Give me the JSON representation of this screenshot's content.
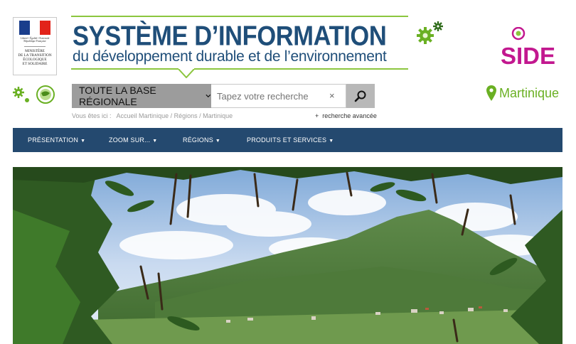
{
  "gov": {
    "motto": "Liberté • Égalité • Fraternité\nRépublique Française",
    "ministry": "MINISTÈRE\nDE LA TRANSITION\nÉCOLOGIQUE\nET SOLIDAIRE"
  },
  "header": {
    "title": "SYSTÈME D’INFORMATION",
    "subtitle": "du développement durable et de l’environnement",
    "brand_color": "#1f4e79",
    "accent_color": "#8cc63f"
  },
  "side": {
    "logo_text": "SIDE",
    "logo_color": "#c2188f",
    "region": "Martinique",
    "region_color": "#6ab023",
    "icons": [
      "location-pin-icon",
      "gear-icon",
      "globe-icon"
    ]
  },
  "search": {
    "scope_label": "TOUTE LA BASE RÉGIONALE",
    "placeholder": "Tapez votre recherche",
    "clear_glyph": "×",
    "advanced_label": "recherche avancée",
    "advanced_prefix": "+"
  },
  "breadcrumb": {
    "prefix": "Vous êtes ici :",
    "items": [
      "Accueil Martinique",
      "Régions",
      "Martinique"
    ]
  },
  "nav": {
    "items": [
      {
        "label": "PRÉSENTATION"
      },
      {
        "label": "ZOOM SUR..."
      },
      {
        "label": "RÉGIONS"
      },
      {
        "label": "PRODUITS ET SERVICES"
      }
    ],
    "background": "#24496f"
  }
}
